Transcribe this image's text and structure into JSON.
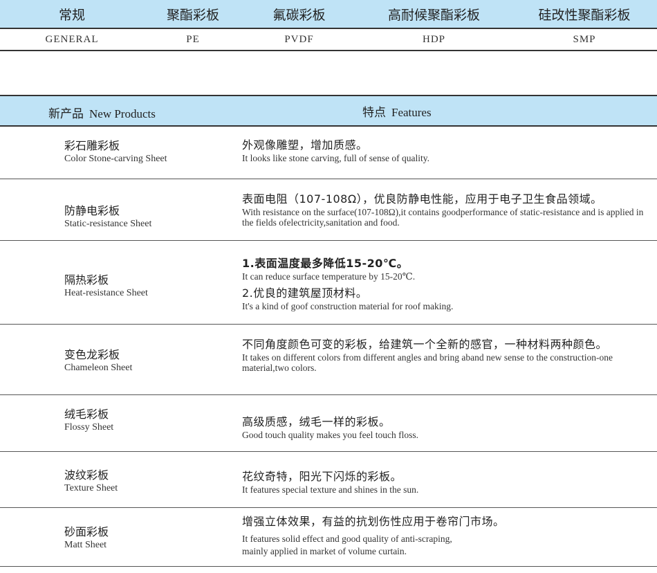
{
  "coatings": {
    "headers": [
      "常规",
      "聚酯彩板",
      "氟碳彩板",
      "高耐候聚酯彩板",
      "硅改性聚酯彩板"
    ],
    "codes": [
      "GENERAL",
      "PE",
      "PVDF",
      "HDP",
      "SMP"
    ]
  },
  "products_header": {
    "left_cn": "新产品",
    "left_en": "New Products",
    "right_cn": "特点",
    "right_en": "Features"
  },
  "products": [
    {
      "name_cn": "彩石雕彩板",
      "name_en": "Color Stone-carving Sheet",
      "feat1_cn": "外观像雕塑，增加质感。",
      "feat1_en": "It looks like stone carving, full of sense of quality."
    },
    {
      "name_cn": "防静电彩板",
      "name_en": "Static-resistance Sheet",
      "feat1_cn": "表面电阻（107-108Ω），优良防静电性能，应用于电子卫生食品领域。",
      "feat1_en": "With resistance on the surface(107-108Ω),it contains goodperformance of static-resistance and is applied in the fields ofelectricity,sanitation and food."
    },
    {
      "name_cn": "隔热彩板",
      "name_en": "Heat-resistance Sheet",
      "feat1_cn": "1.表面温度最多降低15-20℃。",
      "feat1_en": "It can reduce surface temperature by 15-20℃.",
      "feat2_cn": "2.优良的建筑屋顶材料。",
      "feat2_en": "It's a kind of goof construction material for roof making."
    },
    {
      "name_cn": "变色龙彩板",
      "name_en": "Chameleon Sheet",
      "feat1_cn": "不同角度颜色可变的彩板，给建筑一个全新的感官，一种材料两种颜色。",
      "feat1_en": "It takes on different colors from different angles and bring aband new sense to the construction-one material,two colors."
    },
    {
      "name_cn": "绒毛彩板",
      "name_en": "Flossy Sheet",
      "feat1_cn": "高级质感，绒毛一样的彩板。",
      "feat1_en": "Good touch quality makes you feel touch floss."
    },
    {
      "name_cn": "波纹彩板",
      "name_en": "Texture Sheet",
      "feat1_cn": "花纹奇特，阳光下闪烁的彩板。",
      "feat1_en": "It features special texture and shines in the sun."
    },
    {
      "name_cn": "砂面彩板",
      "name_en": "Matt Sheet",
      "feat1_cn": "增强立体效果，有益的抗划伤性应用于卷帘门市场。",
      "feat1_en": "It features solid effect and good quality of anti-scraping,",
      "feat2_en": "mainly applied in market of volume curtain."
    }
  ]
}
